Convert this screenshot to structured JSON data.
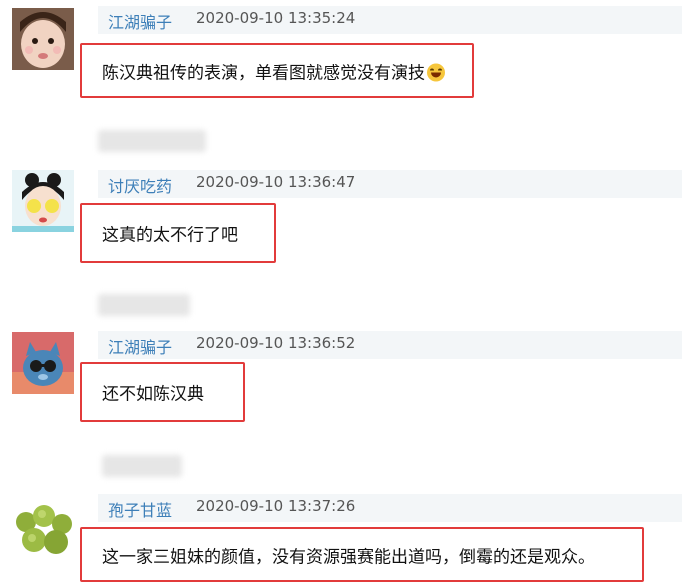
{
  "comments": [
    {
      "username": "江湖骗子",
      "timestamp": "2020-09-10 13:35:24",
      "text": "陈汉典祖传的表演，单看图就感觉没有演技",
      "emoji_icon": "grinning-sweat-emoji"
    },
    {
      "username": "讨厌吃药",
      "timestamp": "2020-09-10 13:36:47",
      "text": "这真的太不行了吧"
    },
    {
      "username": "江湖骗子",
      "timestamp": "2020-09-10 13:36:52",
      "text": "还不如陈汉典"
    },
    {
      "username": "孢子甘蓝",
      "timestamp": "2020-09-10 13:37:26",
      "text": "这一家三姐妹的颜值，没有资源强赛能出道吗，倒霉的还是观众。"
    }
  ],
  "colors": {
    "username": "#3d7fb8",
    "highlight_border": "#e23b3b",
    "meta_background": "#f3f6f8"
  }
}
